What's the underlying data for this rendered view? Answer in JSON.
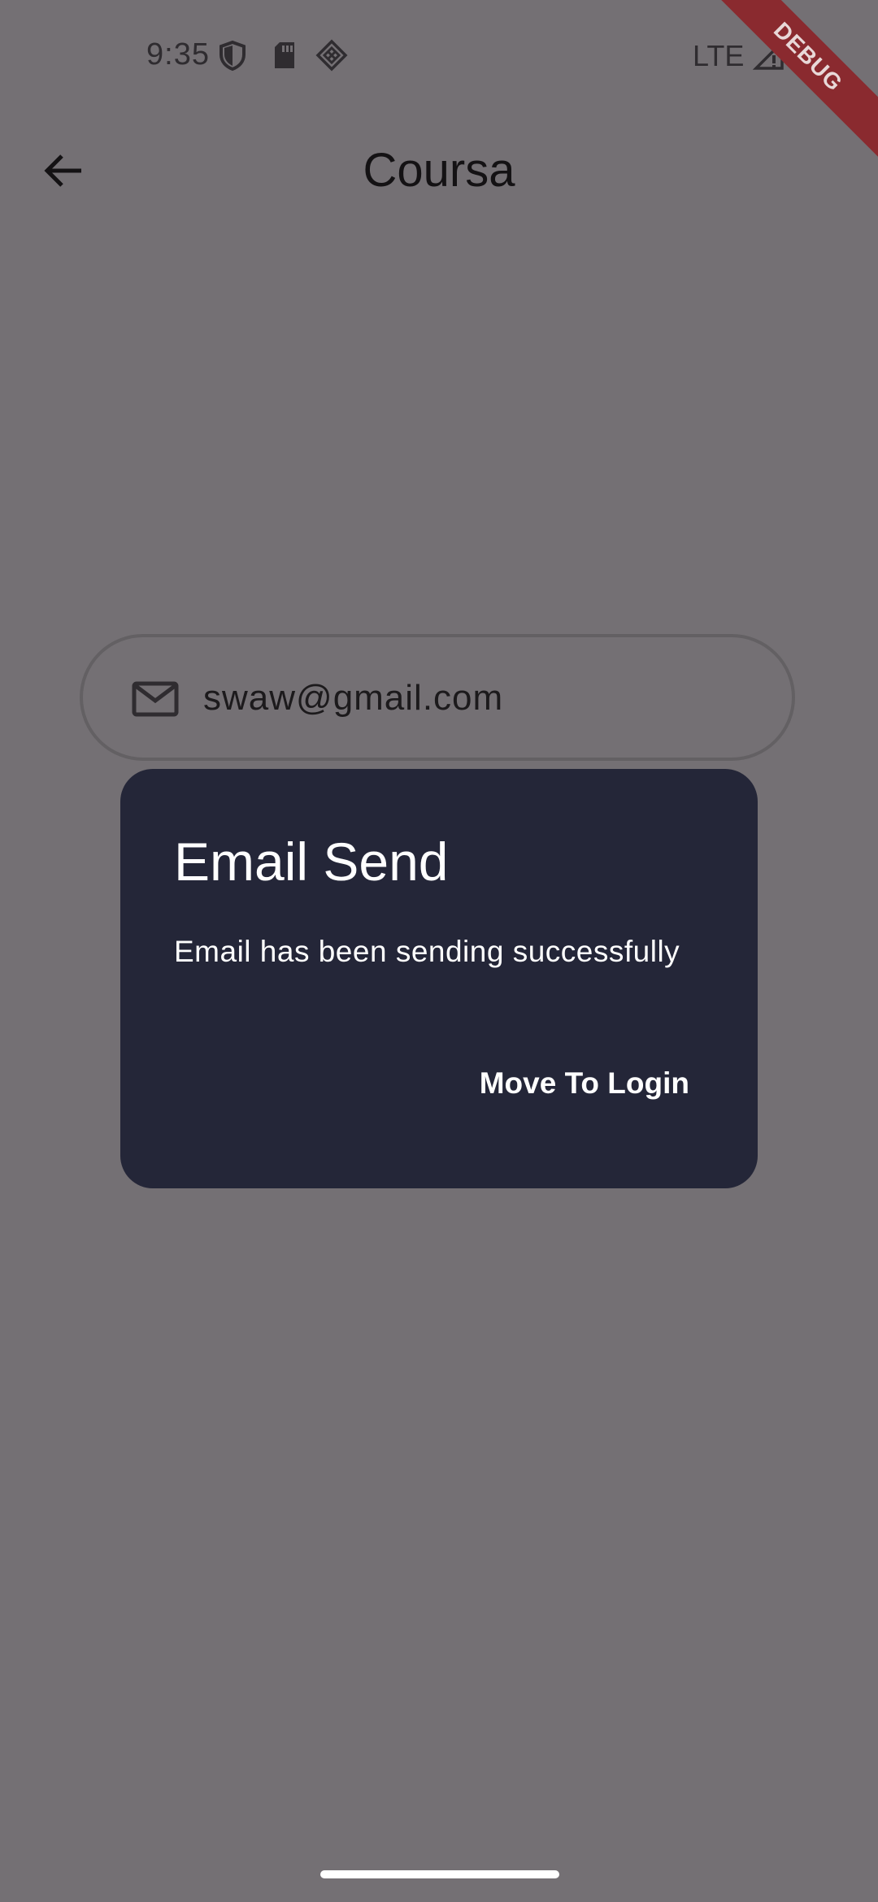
{
  "status_bar": {
    "time": "9:35",
    "network": "LTE",
    "icons": [
      "shield-icon",
      "sd-card-icon",
      "diamond-grid-icon",
      "signal-icon",
      "battery-icon"
    ]
  },
  "debug_banner": {
    "label": "DEBUG",
    "color": "#8a2a2f"
  },
  "app_bar": {
    "title": "Coursa",
    "back_icon": "arrow-left-icon"
  },
  "email_field": {
    "icon": "mail-icon",
    "value": "swaw@gmail.com"
  },
  "dialog": {
    "title": "Email Send",
    "message": "Email has been sending successfully",
    "action_label": "Move To Login",
    "background_color": "#242638"
  },
  "colors": {
    "scrim_background": "#747074"
  }
}
